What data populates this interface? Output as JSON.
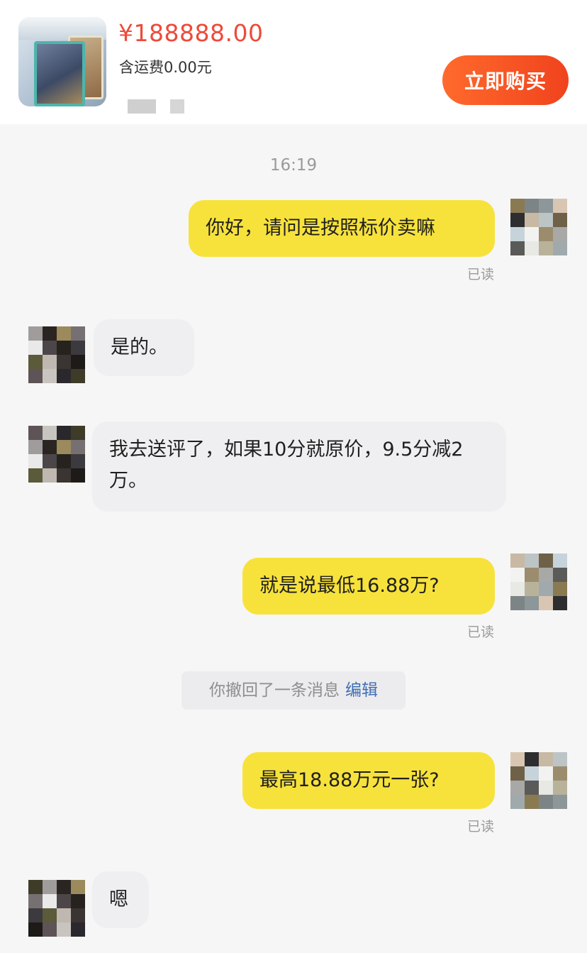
{
  "product": {
    "price": "¥188888.00",
    "shipping": "含运费0.00元",
    "buy_button": "立即购买"
  },
  "chat": {
    "timestamp": "16:19",
    "messages": [
      {
        "side": "out",
        "text": "你好，请问是按照标价卖嘛",
        "status": "已读"
      },
      {
        "side": "in",
        "text": "是的。"
      },
      {
        "side": "in",
        "text": "我去送评了，如果10分就原价，9.5分减2万。"
      },
      {
        "side": "out",
        "text": "就是说最低16.88万?",
        "status": "已读"
      },
      {
        "side": "out",
        "text": "最高18.88万元一张?",
        "status": "已读"
      },
      {
        "side": "in",
        "text": "嗯"
      }
    ],
    "recall_notice": {
      "text": "你撤回了一条消息",
      "edit_label": "编辑"
    }
  },
  "colors": {
    "price_red": "#ee4a3a",
    "buy_button": "#f0431d",
    "outgoing_bubble": "#f7e23b",
    "incoming_bubble": "#efeff1",
    "link_blue": "#3f6fb4"
  },
  "icons": {
    "product_thumbnail": "trading-card-photo",
    "self_avatar": "pixelated-avatar",
    "seller_avatar": "pixelated-avatar"
  }
}
